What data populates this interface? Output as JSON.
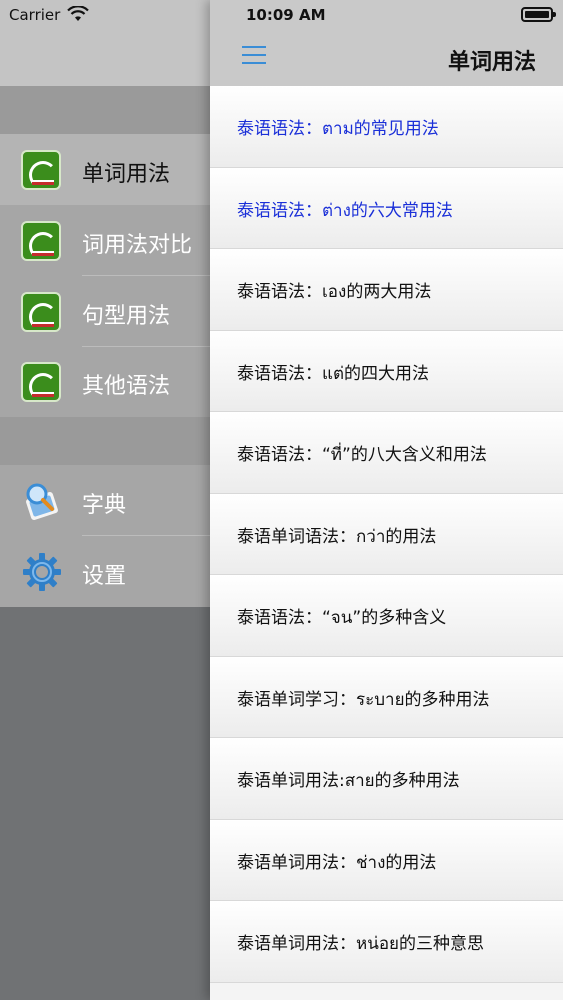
{
  "status_bar": {
    "carrier": "Carrier",
    "time": "10:09 AM"
  },
  "header": {
    "title": "单词用法"
  },
  "drawer": {
    "group_a": [
      {
        "label": "单词用法",
        "icon": "grammar-book-icon",
        "selected": true
      },
      {
        "label": "词用法对比",
        "icon": "grammar-book-icon",
        "selected": false
      },
      {
        "label": "句型用法",
        "icon": "grammar-book-icon",
        "selected": false
      },
      {
        "label": "其他语法",
        "icon": "grammar-book-icon",
        "selected": false
      }
    ],
    "group_b": [
      {
        "label": "字典",
        "icon": "dictionary-icon"
      },
      {
        "label": "设置",
        "icon": "gear-icon"
      }
    ]
  },
  "articles": [
    {
      "title": "泰语语法：ตาม的常见用法",
      "highlighted": true
    },
    {
      "title": "泰语语法：ต่าง的六大常用法",
      "highlighted": true
    },
    {
      "title": "泰语语法：เอง的两大用法",
      "highlighted": false
    },
    {
      "title": "泰语语法：แต่的四大用法",
      "highlighted": false
    },
    {
      "title": "泰语语法：“ที่”的八大含义和用法",
      "highlighted": false
    },
    {
      "title": "泰语单词语法：กว่า的用法",
      "highlighted": false
    },
    {
      "title": "泰语语法：“จน”的多种含义",
      "highlighted": false
    },
    {
      "title": "泰语单词学习：ระบาย的多种用法",
      "highlighted": false
    },
    {
      "title": "泰语单词用法:สาย的多种用法",
      "highlighted": false
    },
    {
      "title": "泰语单词用法：ช่าง的用法",
      "highlighted": false
    },
    {
      "title": "泰语单词用法：หน่อย的三种意思",
      "highlighted": false
    }
  ],
  "colors": {
    "accent": "#3a8dd6",
    "highlight_text": "#1a2fd8",
    "drawer_bg": "#a6a6a6"
  }
}
